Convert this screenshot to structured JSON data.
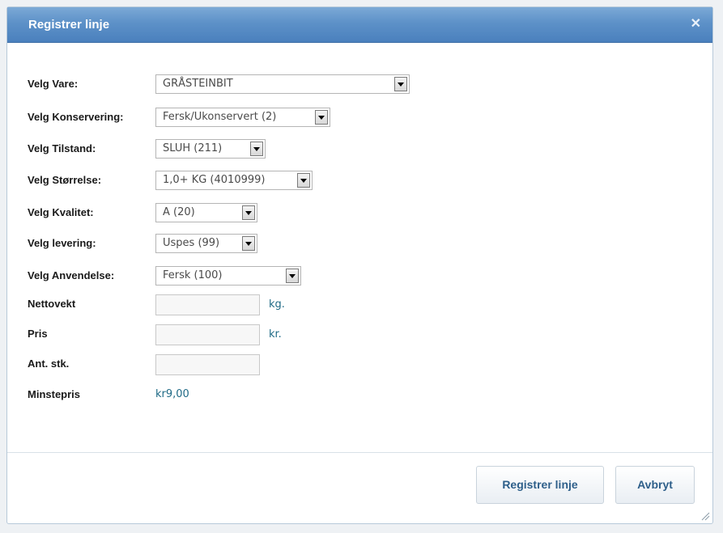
{
  "dialog": {
    "title": "Registrer linje",
    "close_icon": "close-icon"
  },
  "form": {
    "vare": {
      "label": "Velg Vare:",
      "value": "GRÅSTEINBIT"
    },
    "konservering": {
      "label": "Velg Konservering:",
      "value": "Fersk/Ukonservert (2)"
    },
    "tilstand": {
      "label": "Velg Tilstand:",
      "value": "SLUH (211)"
    },
    "storrelse": {
      "label": "Velg Størrelse:",
      "value": "1,0+ KG (4010999)"
    },
    "kvalitet": {
      "label": "Velg Kvalitet:",
      "value": "A (20)"
    },
    "levering": {
      "label": "Velg levering:",
      "value": "Uspes (99)"
    },
    "anvendelse": {
      "label": "Velg Anvendelse:",
      "value": "Fersk (100)"
    },
    "nettovekt": {
      "label": "Nettovekt",
      "value": "",
      "unit": "kg."
    },
    "pris": {
      "label": "Pris",
      "value": "",
      "unit": "kr."
    },
    "antstk": {
      "label": "Ant. stk.",
      "value": ""
    },
    "minstepris": {
      "label": "Minstepris",
      "value": "kr9,00"
    }
  },
  "buttons": {
    "register": "Registrer linje",
    "cancel": "Avbryt"
  },
  "colors": {
    "titlebar": "#5d91c8",
    "link_text": "#1f6a86",
    "button_text": "#2e5f8a"
  }
}
